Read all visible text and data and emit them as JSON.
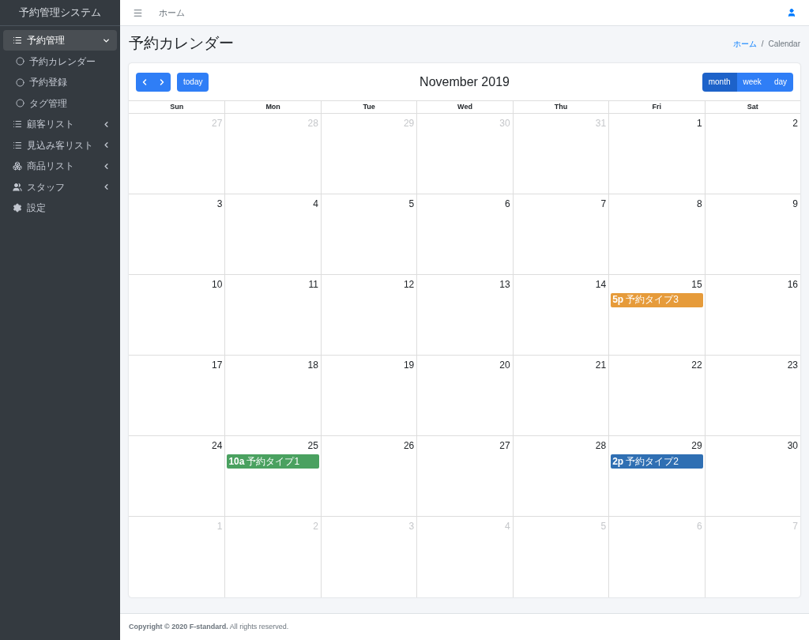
{
  "brand": "予約管理システム",
  "sidebar": {
    "items": [
      {
        "kind": "group",
        "label": "予約管理",
        "expanded": true,
        "selected": true
      },
      {
        "kind": "link",
        "label": "予約カレンダー"
      },
      {
        "kind": "link",
        "label": "予約登録"
      },
      {
        "kind": "link",
        "label": "タグ管理"
      },
      {
        "kind": "group",
        "label": "顧客リスト",
        "expanded": false,
        "selected": false
      },
      {
        "kind": "group",
        "label": "見込み客リスト",
        "expanded": false,
        "selected": false
      },
      {
        "kind": "group",
        "label": "商品リスト",
        "expanded": false,
        "selected": false
      },
      {
        "kind": "group",
        "label": "スタッフ",
        "expanded": false,
        "selected": false
      },
      {
        "kind": "single",
        "label": "設定"
      }
    ]
  },
  "topbar": {
    "link": "ホーム"
  },
  "page_title": "予約カレンダー",
  "breadcrumb": [
    {
      "label": "ホーム",
      "kind": "link"
    },
    {
      "label": "/",
      "kind": "separator"
    },
    {
      "label": "Calendar",
      "kind": "current"
    }
  ],
  "calendar": {
    "title": "November 2019",
    "today_label": "today",
    "views": [
      {
        "label": "month",
        "selected": true
      },
      {
        "label": "week",
        "selected": false
      },
      {
        "label": "day",
        "selected": false
      }
    ],
    "weekdays": [
      "Sun",
      "Mon",
      "Tue",
      "Wed",
      "Thu",
      "Fri",
      "Sat"
    ],
    "weeks": [
      [
        {
          "day": "27",
          "muted": true
        },
        {
          "day": "28",
          "muted": true
        },
        {
          "day": "29",
          "muted": true
        },
        {
          "day": "30",
          "muted": true
        },
        {
          "day": "31",
          "muted": true
        },
        {
          "day": "1",
          "muted": false
        },
        {
          "day": "2",
          "muted": false
        }
      ],
      [
        {
          "day": "3",
          "muted": false
        },
        {
          "day": "4",
          "muted": false
        },
        {
          "day": "5",
          "muted": false
        },
        {
          "day": "6",
          "muted": false
        },
        {
          "day": "7",
          "muted": false
        },
        {
          "day": "8",
          "muted": false
        },
        {
          "day": "9",
          "muted": false
        }
      ],
      [
        {
          "day": "10",
          "muted": false
        },
        {
          "day": "11",
          "muted": false
        },
        {
          "day": "12",
          "muted": false
        },
        {
          "day": "13",
          "muted": false
        },
        {
          "day": "14",
          "muted": false
        },
        {
          "day": "15",
          "muted": false,
          "events": [
            {
              "time": "5p",
              "title": "予約タイプ3",
              "color": "#e69b3a"
            }
          ]
        },
        {
          "day": "16",
          "muted": false
        }
      ],
      [
        {
          "day": "17",
          "muted": false
        },
        {
          "day": "18",
          "muted": false
        },
        {
          "day": "19",
          "muted": false
        },
        {
          "day": "20",
          "muted": false
        },
        {
          "day": "21",
          "muted": false
        },
        {
          "day": "22",
          "muted": false
        },
        {
          "day": "23",
          "muted": false
        }
      ],
      [
        {
          "day": "24",
          "muted": false
        },
        {
          "day": "25",
          "muted": false,
          "events": [
            {
              "time": "10a",
              "title": "予約タイプ1",
              "color": "#4aa160"
            }
          ]
        },
        {
          "day": "26",
          "muted": false
        },
        {
          "day": "27",
          "muted": false
        },
        {
          "day": "28",
          "muted": false
        },
        {
          "day": "29",
          "muted": false,
          "events": [
            {
              "time": "2p",
              "title": "予約タイプ2",
              "color": "#2f6fb3"
            }
          ]
        },
        {
          "day": "30",
          "muted": false
        }
      ],
      [
        {
          "day": "1",
          "muted": true
        },
        {
          "day": "2",
          "muted": true
        },
        {
          "day": "3",
          "muted": true
        },
        {
          "day": "4",
          "muted": true
        },
        {
          "day": "5",
          "muted": true
        },
        {
          "day": "6",
          "muted": true
        },
        {
          "day": "7",
          "muted": true
        }
      ]
    ]
  },
  "footer": "**Copyright © 2020 F-standard.** All rights reserved."
}
